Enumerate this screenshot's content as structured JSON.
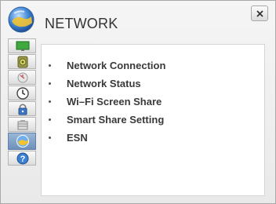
{
  "header": {
    "title": "NETWORK",
    "icon": "network-globe-icon",
    "close_icon": "close-icon"
  },
  "sidebar": {
    "items": [
      {
        "icon": "picture-icon",
        "active": false
      },
      {
        "icon": "sound-icon",
        "active": false
      },
      {
        "icon": "channel-icon",
        "active": false
      },
      {
        "icon": "time-icon",
        "active": false
      },
      {
        "icon": "lock-icon",
        "active": false
      },
      {
        "icon": "option-icon",
        "active": false
      },
      {
        "icon": "network-icon",
        "active": true
      },
      {
        "icon": "support-icon",
        "active": false
      }
    ]
  },
  "menu": {
    "items": [
      {
        "label": "Network Connection"
      },
      {
        "label": "Network Status"
      },
      {
        "label": "Wi–Fi Screen Share"
      },
      {
        "label": "Smart Share Setting"
      },
      {
        "label": "ESN"
      }
    ]
  },
  "colors": {
    "active_tab": "#7b9ac3",
    "window_bg": "#efefef",
    "text": "#3a3a3a"
  }
}
